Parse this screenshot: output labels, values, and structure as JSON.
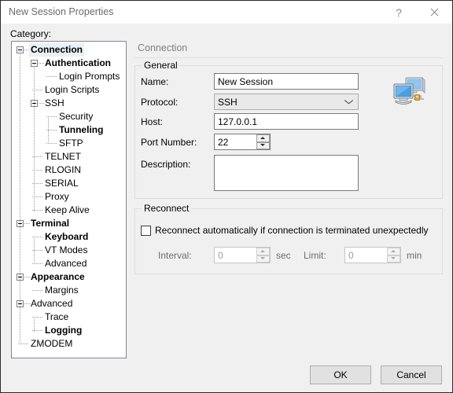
{
  "window": {
    "title": "New Session Properties",
    "help_button": "?",
    "close_button": "close-icon"
  },
  "category": {
    "label": "Category:",
    "tree": [
      {
        "label": "Connection",
        "depth": 0,
        "bold": true,
        "selected": true,
        "expander": true
      },
      {
        "label": "Authentication",
        "depth": 1,
        "bold": true,
        "selected": false,
        "expander": true
      },
      {
        "label": "Login Prompts",
        "depth": 2,
        "bold": false,
        "selected": false,
        "expander": false
      },
      {
        "label": "Login Scripts",
        "depth": 1,
        "bold": false,
        "selected": false,
        "expander": false
      },
      {
        "label": "SSH",
        "depth": 1,
        "bold": false,
        "selected": false,
        "expander": true
      },
      {
        "label": "Security",
        "depth": 2,
        "bold": false,
        "selected": false,
        "expander": false
      },
      {
        "label": "Tunneling",
        "depth": 2,
        "bold": true,
        "selected": false,
        "expander": false
      },
      {
        "label": "SFTP",
        "depth": 2,
        "bold": false,
        "selected": false,
        "expander": false
      },
      {
        "label": "TELNET",
        "depth": 1,
        "bold": false,
        "selected": false,
        "expander": false
      },
      {
        "label": "RLOGIN",
        "depth": 1,
        "bold": false,
        "selected": false,
        "expander": false
      },
      {
        "label": "SERIAL",
        "depth": 1,
        "bold": false,
        "selected": false,
        "expander": false
      },
      {
        "label": "Proxy",
        "depth": 1,
        "bold": false,
        "selected": false,
        "expander": false
      },
      {
        "label": "Keep Alive",
        "depth": 1,
        "bold": false,
        "selected": false,
        "expander": false
      },
      {
        "label": "Terminal",
        "depth": 0,
        "bold": true,
        "selected": false,
        "expander": true
      },
      {
        "label": "Keyboard",
        "depth": 1,
        "bold": true,
        "selected": false,
        "expander": false
      },
      {
        "label": "VT Modes",
        "depth": 1,
        "bold": false,
        "selected": false,
        "expander": false
      },
      {
        "label": "Advanced",
        "depth": 1,
        "bold": false,
        "selected": false,
        "expander": false
      },
      {
        "label": "Appearance",
        "depth": 0,
        "bold": true,
        "selected": false,
        "expander": true
      },
      {
        "label": "Margins",
        "depth": 1,
        "bold": false,
        "selected": false,
        "expander": false
      },
      {
        "label": "Advanced",
        "depth": 0,
        "bold": false,
        "selected": false,
        "expander": true
      },
      {
        "label": "Trace",
        "depth": 1,
        "bold": false,
        "selected": false,
        "expander": false
      },
      {
        "label": "Logging",
        "depth": 1,
        "bold": true,
        "selected": false,
        "expander": false
      },
      {
        "label": "ZMODEM",
        "depth": 0,
        "bold": false,
        "selected": false,
        "expander": false
      }
    ]
  },
  "pane": {
    "header": "Connection",
    "general": {
      "title": "General",
      "name_label": "Name:",
      "name_value": "New Session",
      "protocol_label": "Protocol:",
      "protocol_value": "SSH",
      "host_label": "Host:",
      "host_value": "127.0.0.1",
      "port_label": "Port Number:",
      "port_value": "22",
      "description_label": "Description:",
      "description_value": "",
      "icon": "network-computers-icon"
    },
    "reconnect": {
      "title": "Reconnect",
      "checkbox_label": "Reconnect automatically if connection is terminated unexpectedly",
      "checkbox_checked": false,
      "interval_label": "Interval:",
      "interval_value": "0",
      "interval_unit": "sec",
      "limit_label": "Limit:",
      "limit_value": "0",
      "limit_unit": "min"
    }
  },
  "footer": {
    "ok_label": "OK",
    "cancel_label": "Cancel"
  },
  "colors": {
    "window_bg": "#f0f0f0",
    "titlebar_bg": "#ffffff",
    "selection": "#e9f0f8",
    "header_text": "#808080",
    "monitor_blue": "#4a9fe0",
    "lock_gold": "#e8a33d"
  }
}
